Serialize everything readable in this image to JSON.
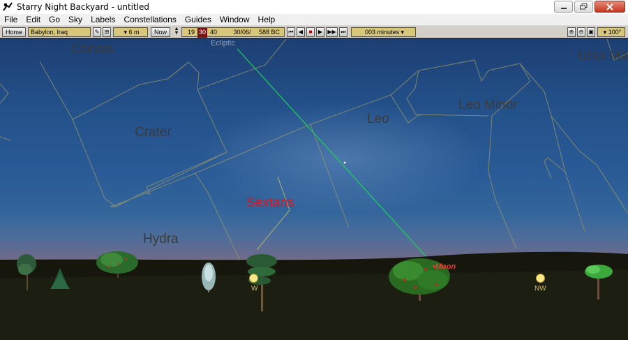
{
  "window": {
    "title": "Starry Night Backyard - untitled"
  },
  "menu": [
    "File",
    "Edit",
    "Go",
    "Sky",
    "Labels",
    "Constellations",
    "Guides",
    "Window",
    "Help"
  ],
  "toolbar": {
    "home_label": "Home",
    "location": "Babylon, Iraq",
    "elevation": "6 m",
    "now_label": "Now",
    "time_hour": "19",
    "time_minute": "30",
    "time_second": "40",
    "date": "30/06/",
    "year": "588 BC",
    "time_step": "003 minutes",
    "fov": "100°"
  },
  "sky": {
    "constellations": {
      "corvus": "Corvus",
      "crater": "Crater",
      "leo": "Leo",
      "leo_minor": "Leo Minor",
      "ursa_major": "Ursa Ma",
      "hydra": "Hydra",
      "sextans": "Sextans"
    },
    "ecliptic_label": "Ecliptic",
    "moon_label": "Moon",
    "directions": {
      "west": "W",
      "northwest": "NW"
    }
  },
  "colors": {
    "sky_top": "#1d3f73",
    "horizon": "#9f6f80",
    "ground": "#1a1a10",
    "constellation_boundary": "#9a9a6a",
    "ecliptic": "#1fd05a",
    "selected_label": "#e0141c",
    "toolbar_field": "#d8c77a"
  }
}
